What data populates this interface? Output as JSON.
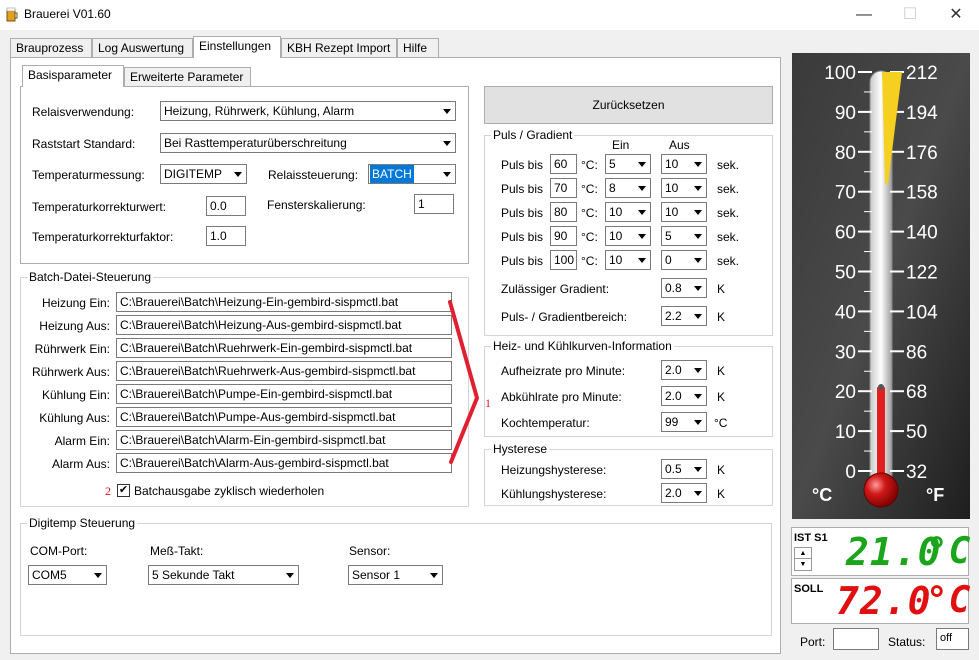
{
  "window": {
    "title": "Brauerei V01.60",
    "minimize": "—",
    "maximize": "☐",
    "close": "✕"
  },
  "tabs": [
    "Brauprozess",
    "Log Auswertung",
    "Einstellungen",
    "KBH Rezept Import",
    "Hilfe"
  ],
  "subtabs": [
    "Basisparameter",
    "Erweiterte Parameter"
  ],
  "basis": {
    "relais_label": "Relaisverwendung:",
    "relais_value": "Heizung, Rührwerk, Kühlung, Alarm",
    "raststart_label": "Raststart Standard:",
    "raststart_value": "Bei Rasttemperaturüberschreitung",
    "tempmess_label": "Temperaturmessung:",
    "tempmess_value": "DIGITEMP",
    "relaissteuer_label": "Relaissteuerung:",
    "relaissteuer_value": "BATCH",
    "korrwert_label": "Temperaturkorrekturwert:",
    "korrwert_value": "0.0",
    "fenster_label": "Fensterskalierung:",
    "fenster_value": "1",
    "korrfaktor_label": "Temperaturkorrekturfaktor:",
    "korrfaktor_value": "1.0"
  },
  "batch": {
    "title": "Batch-Datei-Steuerung",
    "rows": [
      {
        "label": "Heizung Ein:",
        "value": "C:\\Brauerei\\Batch\\Heizung-Ein-gembird-sispmctl.bat"
      },
      {
        "label": "Heizung Aus:",
        "value": "C:\\Brauerei\\Batch\\Heizung-Aus-gembird-sispmctl.bat"
      },
      {
        "label": "Rührwerk Ein:",
        "value": "C:\\Brauerei\\Batch\\Ruehrwerk-Ein-gembird-sispmctl.bat"
      },
      {
        "label": "Rührwerk Aus:",
        "value": "C:\\Brauerei\\Batch\\Ruehrwerk-Aus-gembird-sispmctl.bat"
      },
      {
        "label": "Kühlung Ein:",
        "value": "C:\\Brauerei\\Batch\\Pumpe-Ein-gembird-sispmctl.bat"
      },
      {
        "label": "Kühlung Aus:",
        "value": "C:\\Brauerei\\Batch\\Pumpe-Aus-gembird-sispmctl.bat"
      },
      {
        "label": "Alarm Ein:",
        "value": "C:\\Brauerei\\Batch\\Alarm-Ein-gembird-sispmctl.bat"
      },
      {
        "label": "Alarm Aus:",
        "value": "C:\\Brauerei\\Batch\\Alarm-Aus-gembird-sispmctl.bat"
      }
    ],
    "checkbox_label": "Batchausgabe zyklisch wiederholen",
    "checkbox_mark": "✔",
    "annotation_2": "2"
  },
  "annotation_1": "1",
  "digitemp": {
    "title": "Digitemp Steuerung",
    "com_label": "COM-Port:",
    "com_value": "COM5",
    "takt_label": "Meß-Takt:",
    "takt_value": "5 Sekunde Takt",
    "sensor_label": "Sensor:",
    "sensor_value": "Sensor 1"
  },
  "reset_button": "Zurücksetzen",
  "puls": {
    "title": "Puls / Gradient",
    "ein_header": "Ein",
    "aus_header": "Aus",
    "row_label": "Puls bis",
    "unit_c": "°C:",
    "unit_sek": "sek.",
    "rows": [
      {
        "temp": "60",
        "ein": "5",
        "aus": "10"
      },
      {
        "temp": "70",
        "ein": "8",
        "aus": "10"
      },
      {
        "temp": "80",
        "ein": "10",
        "aus": "10"
      },
      {
        "temp": "90",
        "ein": "10",
        "aus": "5"
      },
      {
        "temp": "100",
        "ein": "10",
        "aus": "0"
      }
    ],
    "gradient_label": "Zulässiger Gradient:",
    "gradient_value": "0.8",
    "gradient_unit": "K",
    "bereich_label": "Puls- / Gradientbereich:",
    "bereich_value": "2.2",
    "bereich_unit": "K"
  },
  "kurven": {
    "title": "Heiz- und Kühlkurven-Information",
    "aufheiz_label": "Aufheizrate pro Minute:",
    "aufheiz_value": "2.0",
    "aufheiz_unit": "K",
    "abkuehl_label": "Abkühlrate pro Minute:",
    "abkuehl_value": "2.0",
    "abkuehl_unit": "K",
    "koch_label": "Kochtemperatur:",
    "koch_value": "99",
    "koch_unit": "°C"
  },
  "hysterese": {
    "title": "Hysterese",
    "heiz_label": "Heizungshysterese:",
    "heiz_value": "0.5",
    "heiz_unit": "K",
    "kuehl_label": "Kühlungshysterese:",
    "kuehl_value": "2.0",
    "kuehl_unit": "K"
  },
  "thermometer": {
    "celsius_ticks": [
      "100",
      "90",
      "80",
      "70",
      "60",
      "50",
      "40",
      "30",
      "20",
      "10",
      "0"
    ],
    "fahrenheit_ticks": [
      "212",
      "194",
      "176",
      "158",
      "140",
      "122",
      "104",
      "86",
      "68",
      "50",
      "32"
    ],
    "c_label": "°C",
    "f_label": "°F",
    "ist_level_c": 21.0,
    "soll_level_c": 72.0,
    "ist_color": "#e02020",
    "soll_color": "#f5d020"
  },
  "ist": {
    "label": "IST S1",
    "value": "21.0",
    "unit": "°C",
    "color": "#1aa51a"
  },
  "soll": {
    "label": "SOLL",
    "value": "72.0",
    "unit": "°C",
    "color": "#e01010"
  },
  "footer": {
    "port_label": "Port:",
    "status_label": "Status:",
    "status_value": "off"
  }
}
